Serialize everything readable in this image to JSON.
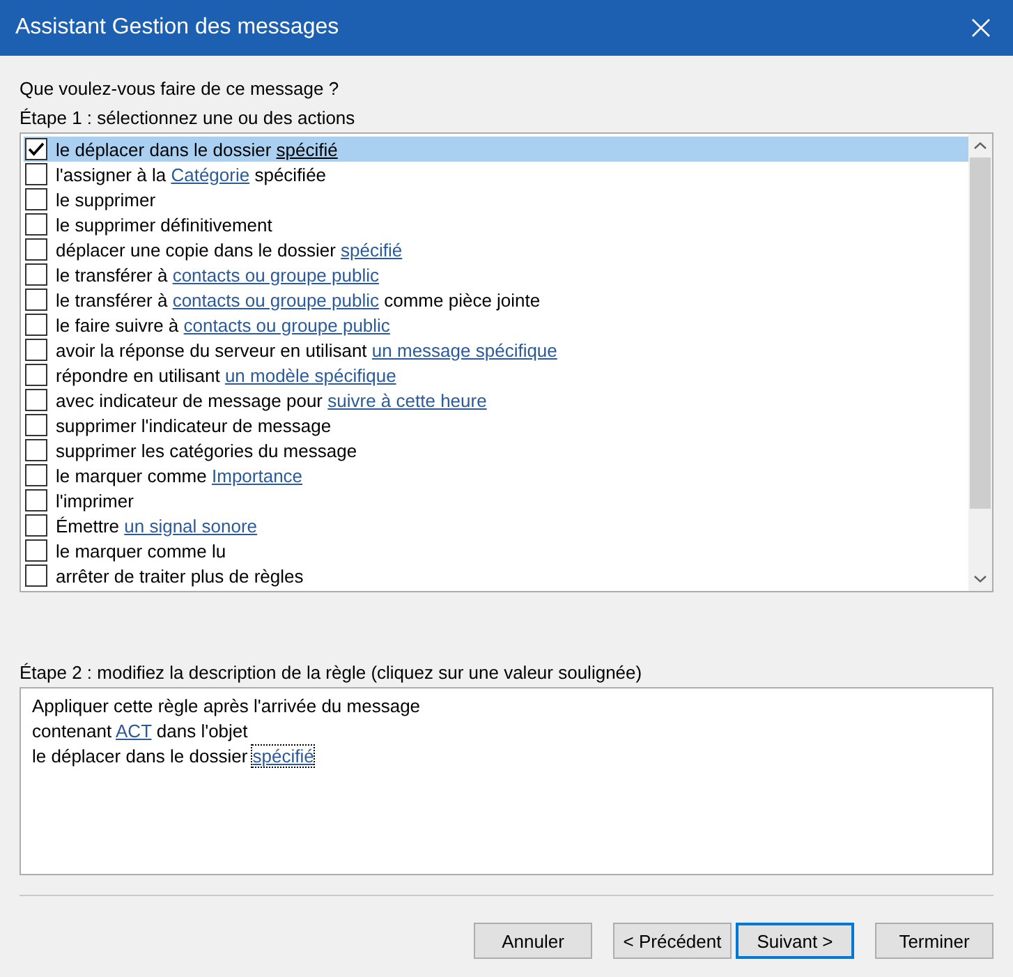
{
  "window": {
    "title": "Assistant Gestion des messages"
  },
  "question": "Que voulez-vous faire de ce message ?",
  "step1": {
    "label": "Étape 1 : sélectionnez une ou des actions",
    "actions": [
      {
        "checked": true,
        "selected": true,
        "parts": [
          {
            "kind": "text",
            "text": "le déplacer dans le dossier"
          },
          {
            "kind": "link",
            "text": "spécifié"
          }
        ]
      },
      {
        "checked": false,
        "selected": false,
        "parts": [
          {
            "kind": "text",
            "text": "l'assigner à la"
          },
          {
            "kind": "link",
            "text": "Catégorie"
          },
          {
            "kind": "text",
            "text": "spécifiée"
          }
        ]
      },
      {
        "checked": false,
        "selected": false,
        "parts": [
          {
            "kind": "text",
            "text": "le supprimer"
          }
        ]
      },
      {
        "checked": false,
        "selected": false,
        "parts": [
          {
            "kind": "text",
            "text": "le supprimer définitivement"
          }
        ]
      },
      {
        "checked": false,
        "selected": false,
        "parts": [
          {
            "kind": "text",
            "text": "déplacer une copie dans le dossier"
          },
          {
            "kind": "link",
            "text": "spécifié"
          }
        ]
      },
      {
        "checked": false,
        "selected": false,
        "parts": [
          {
            "kind": "text",
            "text": "le transférer à"
          },
          {
            "kind": "link",
            "text": "contacts ou groupe public"
          }
        ]
      },
      {
        "checked": false,
        "selected": false,
        "parts": [
          {
            "kind": "text",
            "text": "le transférer à"
          },
          {
            "kind": "link",
            "text": "contacts ou groupe public"
          },
          {
            "kind": "text",
            "text": "comme pièce jointe"
          }
        ]
      },
      {
        "checked": false,
        "selected": false,
        "parts": [
          {
            "kind": "text",
            "text": "le faire suivre à"
          },
          {
            "kind": "link",
            "text": "contacts ou groupe public"
          }
        ]
      },
      {
        "checked": false,
        "selected": false,
        "parts": [
          {
            "kind": "text",
            "text": "avoir la réponse du serveur en utilisant"
          },
          {
            "kind": "link",
            "text": "un message spécifique"
          }
        ]
      },
      {
        "checked": false,
        "selected": false,
        "parts": [
          {
            "kind": "text",
            "text": "répondre en utilisant"
          },
          {
            "kind": "link",
            "text": "un modèle spécifique"
          }
        ]
      },
      {
        "checked": false,
        "selected": false,
        "parts": [
          {
            "kind": "text",
            "text": "avec indicateur de message pour"
          },
          {
            "kind": "link",
            "text": "suivre à cette heure"
          }
        ]
      },
      {
        "checked": false,
        "selected": false,
        "parts": [
          {
            "kind": "text",
            "text": "supprimer l'indicateur de message"
          }
        ]
      },
      {
        "checked": false,
        "selected": false,
        "parts": [
          {
            "kind": "text",
            "text": "supprimer les catégories du message"
          }
        ]
      },
      {
        "checked": false,
        "selected": false,
        "parts": [
          {
            "kind": "text",
            "text": "le marquer comme"
          },
          {
            "kind": "link",
            "text": "Importance"
          }
        ]
      },
      {
        "checked": false,
        "selected": false,
        "parts": [
          {
            "kind": "text",
            "text": "l'imprimer"
          }
        ]
      },
      {
        "checked": false,
        "selected": false,
        "parts": [
          {
            "kind": "text",
            "text": "Émettre"
          },
          {
            "kind": "link",
            "text": "un signal sonore"
          }
        ]
      },
      {
        "checked": false,
        "selected": false,
        "parts": [
          {
            "kind": "text",
            "text": "le marquer comme lu"
          }
        ]
      },
      {
        "checked": false,
        "selected": false,
        "parts": [
          {
            "kind": "text",
            "text": "arrêter de traiter plus de règles"
          }
        ]
      }
    ]
  },
  "step2": {
    "label": "Étape 2 : modifiez la description de la règle (cliquez sur une valeur soulignée)",
    "lines": [
      [
        {
          "kind": "text",
          "text": "Appliquer cette règle après l'arrivée du message"
        }
      ],
      [
        {
          "kind": "text",
          "text": "contenant"
        },
        {
          "kind": "link",
          "text": "ACT",
          "focused": false
        },
        {
          "kind": "text",
          "text": "dans l'objet"
        }
      ],
      [
        {
          "kind": "text",
          "text": "le déplacer dans le dossier"
        },
        {
          "kind": "link",
          "text": "spécifié",
          "focused": true
        }
      ]
    ]
  },
  "buttons": [
    {
      "label": "Annuler",
      "default": false
    },
    {
      "label": "< Précédent",
      "default": false
    },
    {
      "label": "Suivant >",
      "default": true
    },
    {
      "label": "Terminer",
      "default": false
    }
  ]
}
